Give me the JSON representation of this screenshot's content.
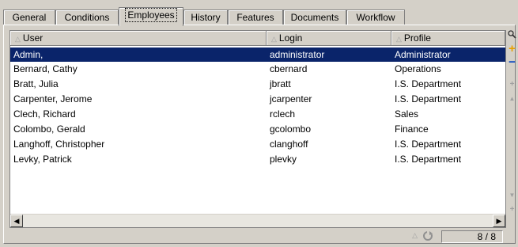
{
  "tabs": [
    {
      "label": "General",
      "active": false
    },
    {
      "label": "Conditions",
      "active": false
    },
    {
      "label": "Employees",
      "active": true
    },
    {
      "label": "History",
      "active": false
    },
    {
      "label": "Features",
      "active": false
    },
    {
      "label": "Documents",
      "active": false
    },
    {
      "label": "Workflow",
      "active": false
    }
  ],
  "columns": [
    "User",
    "Login",
    "Profile"
  ],
  "rows": [
    {
      "user": "Admin,",
      "login": "administrator",
      "profile": "Administrator"
    },
    {
      "user": "Bernard, Cathy",
      "login": "cbernard",
      "profile": "Operations"
    },
    {
      "user": "Bratt, Julia",
      "login": "jbratt",
      "profile": "I.S. Department"
    },
    {
      "user": "Carpenter, Jerome",
      "login": "jcarpenter",
      "profile": "I.S. Department"
    },
    {
      "user": "Clech, Richard",
      "login": "rclech",
      "profile": "Sales"
    },
    {
      "user": "Colombo, Gerald",
      "login": "gcolombo",
      "profile": "Finance"
    },
    {
      "user": "Langhoff, Christopher",
      "login": "clanghoff",
      "profile": "I.S. Department"
    },
    {
      "user": "Levky, Patrick",
      "login": "plevky",
      "profile": "I.S. Department"
    }
  ],
  "selected_row": 0,
  "status": {
    "record_count": "8 / 8"
  },
  "colors": {
    "selection": "#0a246a",
    "add": "#e8a000",
    "remove": "#0040c0"
  }
}
